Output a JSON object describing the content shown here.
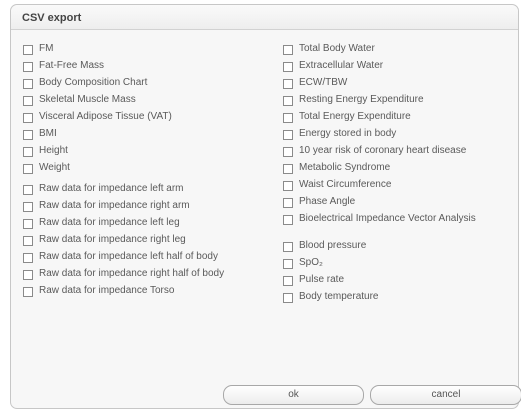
{
  "dialog": {
    "title": "CSV export"
  },
  "left_options": [
    "FM",
    "Fat-Free Mass",
    "Body Composition Chart",
    "Skeletal Muscle Mass",
    "Visceral Adipose Tissue (VAT)",
    "BMI",
    "Height",
    "Weight",
    "Raw data for impedance left arm",
    "Raw data for impedance right arm",
    "Raw data for impedance left leg",
    "Raw data for impedance right leg",
    "Raw data for impedance left half of body",
    "Raw data for impedance right half of body",
    "Raw data for impedance Torso"
  ],
  "right_options": [
    "Total Body Water",
    "Extracellular Water",
    "ECW/TBW",
    "Resting Energy Expenditure",
    "Total Energy Expenditure",
    "Energy stored in body",
    "10 year risk of coronary heart disease",
    "Metabolic Syndrome",
    "Waist Circumference",
    "Phase Angle",
    "Bioelectrical Impedance Vector Analysis",
    "Blood pressure",
    "SpO₂",
    "Pulse rate",
    "Body temperature"
  ],
  "buttons": {
    "ok": "ok",
    "cancel": "cancel"
  }
}
